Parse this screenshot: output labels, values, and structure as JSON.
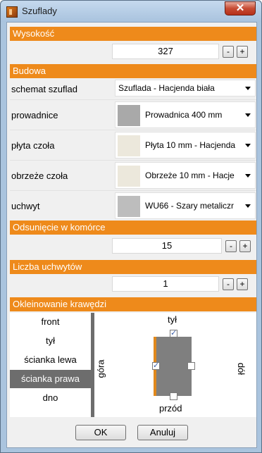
{
  "window": {
    "title": "Szuflady",
    "close_glyph": "✕"
  },
  "height_section": {
    "header": "Wysokość",
    "value": "327",
    "minus": "-",
    "plus": "+"
  },
  "build_section": {
    "header": "Budowa",
    "rows": [
      {
        "label": "schemat szuflad",
        "value": "Szuflada - Hacjenda biała",
        "swatch": null
      },
      {
        "label": "prowadnice",
        "value": "Prowadnica 400 mm",
        "swatch": "#a9a9a9"
      },
      {
        "label": "płyta czoła",
        "value": "Płyta 10 mm - Hacjenda",
        "swatch": "#ece8dc"
      },
      {
        "label": "obrzeże czoła",
        "value": "Obrzeże 10 mm - Hacje",
        "swatch": "#ece8dc"
      },
      {
        "label": "uchwyt",
        "value": "WU66 - Szary metaliczr",
        "swatch": "#bdbdbd"
      }
    ]
  },
  "offset_section": {
    "header": "Odsunięcie w komórce",
    "value": "15",
    "minus": "-",
    "plus": "+"
  },
  "handles_section": {
    "header": "Liczba uchwytów",
    "value": "1",
    "minus": "-",
    "plus": "+"
  },
  "edging_section": {
    "header": "Okleinowanie krawędzi",
    "items": [
      "front",
      "tył",
      "ścianka lewa",
      "ścianka prawa",
      "dno"
    ],
    "selected": "ścianka prawa",
    "labels": {
      "top": "tył",
      "bottom": "przód",
      "left": "góra",
      "right": "dół"
    },
    "checks": {
      "top": true,
      "left": true,
      "right": false,
      "bottom": false
    },
    "panel_color": "#7f7f7f",
    "edge_color": "#e0881c"
  },
  "buttons": {
    "ok": "OK",
    "cancel": "Anuluj"
  }
}
